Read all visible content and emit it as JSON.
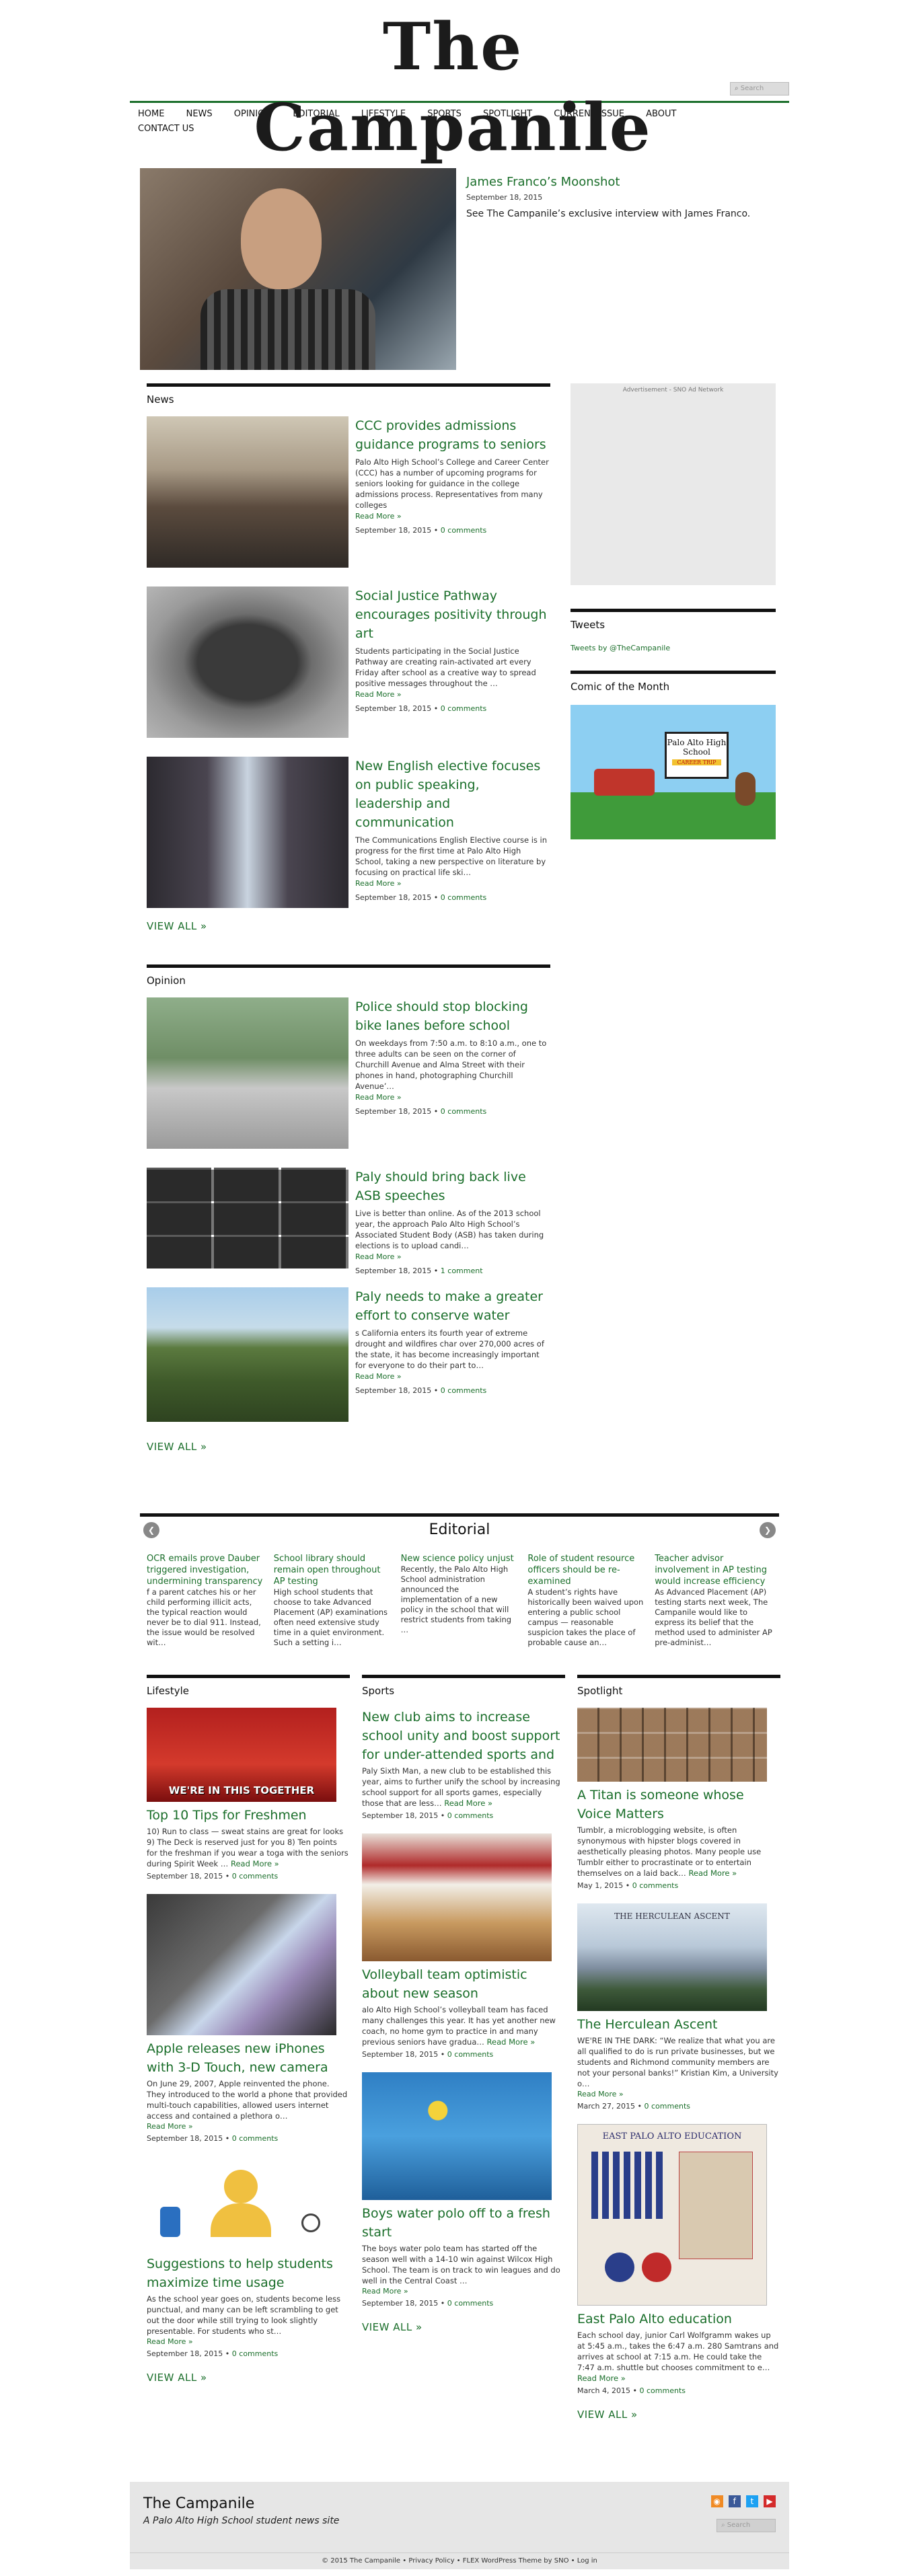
{
  "site": {
    "logo_text": "The Campanile",
    "search_placeholder": "Search"
  },
  "nav": [
    "HOME",
    "NEWS",
    "OPINION",
    "EDITORIAL",
    "LIFESTYLE",
    "SPORTS",
    "SPOTLIGHT",
    "CURRENT ISSUE",
    "ABOUT",
    "CONTACT US"
  ],
  "featured": {
    "title": "James Franco’s Moonshot",
    "date": "September 18, 2015",
    "excerpt": "See The Campanile’s exclusive interview with James Franco."
  },
  "news": {
    "title": "News",
    "items": [
      {
        "title": "CCC provides admissions guidance programs to seniors",
        "excerpt": "Palo Alto High School’s College  and Career Center (CCC) has a number of upcoming programs for seniors looking for guidance in the college admissions process. Representatives from many colleges",
        "more": "Read More »",
        "date": "September 18, 2015",
        "comments": "0 comments"
      },
      {
        "title": "Social Justice Pathway encourages positivity through art",
        "excerpt": "Students participating in the Social Justice Pathway are creating rain-activated art every Friday after school as a creative way to spread positive messages throughout the …",
        "more": "Read More »",
        "date": "September 18, 2015",
        "comments": "0 comments"
      },
      {
        "title": "New English elective focuses on public speaking, leadership and communication",
        "excerpt": "The Communications English Elective course is in progress for the first time at Palo Alto High School, taking a new perspective on literature by focusing on practical life ski…",
        "more": "Read More »",
        "date": "September 18, 2015",
        "comments": "0 comments"
      }
    ],
    "view_all": "VIEW ALL »"
  },
  "opinion": {
    "title": "Opinion",
    "items": [
      {
        "title": "Police should stop blocking bike lanes before school",
        "excerpt": "On weekdays from 7:50 a.m. to 8:10 a.m., one to three adults can be seen on the corner of Churchill Avenue and Alma Street with their phones in hand, photographing Churchill Avenue’…",
        "more": "Read More »",
        "date": "September 18, 2015",
        "comments": "0 comments"
      },
      {
        "title": "Paly should bring back live ASB speeches",
        "excerpt": "Live is better than online. As of the 2013 school year, the approach Palo Alto High School’s Associated Student Body (ASB) has taken during elections is to upload candi…",
        "more": "Read More »",
        "date": "September 18, 2015",
        "comments": "1 comment"
      },
      {
        "title": "Paly needs to make a greater effort to conserve water",
        "excerpt": "s California enters its fourth year of extreme drought and wildfires char over 270,000 acres of the state, it has become increasingly important for everyone to do their part to…",
        "more": "Read More »",
        "date": "September 18, 2015",
        "comments": "0 comments"
      }
    ],
    "view_all": "VIEW ALL »"
  },
  "sidebar": {
    "ad_label": "Advertisement - SNO Ad Network",
    "tweets_title": "Tweets",
    "tweets_link": "Tweets by @TheCampanile",
    "comic_title": "Comic of the Month",
    "comic_sign": "Palo Alto High School",
    "comic_sign2": "CAREER TRIP"
  },
  "editorial": {
    "title": "Editorial",
    "items": [
      {
        "title": "OCR emails prove Dauber triggered investigation, undermining transparency",
        "excerpt": "f a parent catches his or her child performing illicit acts, the typical reaction would never be to dial 911. Instead, the issue would be resolved wit…"
      },
      {
        "title": "School library should remain open throughout AP testing",
        "excerpt": "High school students that choose to take Advanced Placement (AP) examinations often need extensive study time in a quiet environment. Such a setting i…"
      },
      {
        "title": "New science policy unjust",
        "excerpt": "Recently, the Palo Alto High School administration announced the implementation of a new policy in the school that will restrict students from taking …"
      },
      {
        "title": "Role of student resource officers should be re-examined",
        "excerpt": "A student’s rights have historically been waived upon entering a public school campus — reasonable suspicion takes the place of probable cause an…"
      },
      {
        "title": "Teacher advisor involvement in AP testing would increase efficiency",
        "excerpt": "As Advanced Placement (AP) testing starts next week, The Campanile would like to express its belief that the method used to administer AP pre-administ…"
      }
    ]
  },
  "lifestyle": {
    "title": "Lifestyle",
    "banner_text": "WE'RE IN THIS TOGETHER",
    "items": [
      {
        "title": "Top 10 Tips for Freshmen",
        "excerpt": "10) Run to class — sweat stains are great for looks 9) The Deck is reserved just for you 8) Ten points for the freshman if you wear a toga with the seniors during Spirit Week …",
        "more": "Read More »",
        "date": "September 18, 2015",
        "comments": "0 comments"
      },
      {
        "title": "Apple releases new iPhones with 3-D Touch, new camera",
        "excerpt": "On June 29, 2007, Apple reinvented the phone. They introduced to the world a phone that provided multi-touch capabilities, allowed users internet access and contained a plethora o…",
        "more": "Read More »",
        "date": "September 18, 2015",
        "comments": "0 comments"
      },
      {
        "title": "Suggestions to help students maximize time usage",
        "excerpt": "As the school year goes on, students become less punctual, and many can be left scrambling to get out the door while still trying to look slightly presentable. For students who st…",
        "more": "Read More »",
        "date": "September 18, 2015",
        "comments": "0 comments"
      }
    ],
    "view_all": "VIEW ALL »"
  },
  "sports": {
    "title": "Sports",
    "items": [
      {
        "title": "New club aims to increase school unity and boost support for under-attended sports and",
        "excerpt": "Paly Sixth Man, a new club to be established this year, aims to further unify the school by increasing school support for all sports games, especially those that are less…",
        "more": "Read More »",
        "date": "September 18, 2015",
        "comments": "0 comments"
      },
      {
        "title": "Volleyball team optimistic about new season",
        "excerpt": "alo Alto High School’s volleyball team has faced many challenges this year. It has yet another new coach, no home gym to practice in and many previous seniors have gradua…",
        "more": "Read More »",
        "date": "September 18, 2015",
        "comments": "0 comments"
      },
      {
        "title": "Boys water polo off to a fresh start",
        "excerpt": "The boys water polo team has started off the season well with a 14-10 win against Wilcox High School. The team is on track to win leagues and do well in the Central Coast …",
        "more": "Read More »",
        "date": "September 18, 2015",
        "comments": "0 comments"
      }
    ],
    "view_all": "VIEW ALL »"
  },
  "spotlight": {
    "title": "Spotlight",
    "poster_title": "THE HERCULEAN ASCENT",
    "map_title": "EAST PALO ALTO EDUCATION",
    "items": [
      {
        "title": "A Titan is someone whose Voice Matters",
        "excerpt": "Tumblr, a microblogging website, is often synonymous with hipster blogs covered in aesthetically pleasing photos. Many people use Tumblr either to procrastinate or to entertain themselves on a laid back…",
        "more": "Read More »",
        "date": "May 1, 2015",
        "comments": "0 comments"
      },
      {
        "title": "The Herculean Ascent",
        "excerpt": "WE'RE IN THE DARK: “We realize that what you are all qualified to do is run private businesses, but we students and Richmond community members are not your personal banks!” Kristian Kim, a University o…",
        "more": "Read More »",
        "date": "March 27, 2015",
        "comments": "0 comments"
      },
      {
        "title": "East Palo Alto education",
        "excerpt": "Each school day, junior Carl Wolfgramm wakes up at 5:45 a.m., takes the 6:47 a.m. 280 Samtrans and arrives at school at 7:15 a.m. He could take the 7:47 a.m. shuttle but chooses commitment to e…",
        "more": "Read More »",
        "date": "March 4, 2015",
        "comments": "0 comments"
      }
    ],
    "view_all": "VIEW ALL »"
  },
  "footer": {
    "name": "The Campanile",
    "tagline": "A Palo Alto High School student news site",
    "search_placeholder": "Search",
    "copyright": "© 2015 The Campanile",
    "privacy": "Privacy Policy",
    "theme": "FLEX WordPress Theme by SNO",
    "login": "Log in"
  },
  "colors": {
    "accent": "#1a6e2a",
    "rule": "#111111"
  }
}
